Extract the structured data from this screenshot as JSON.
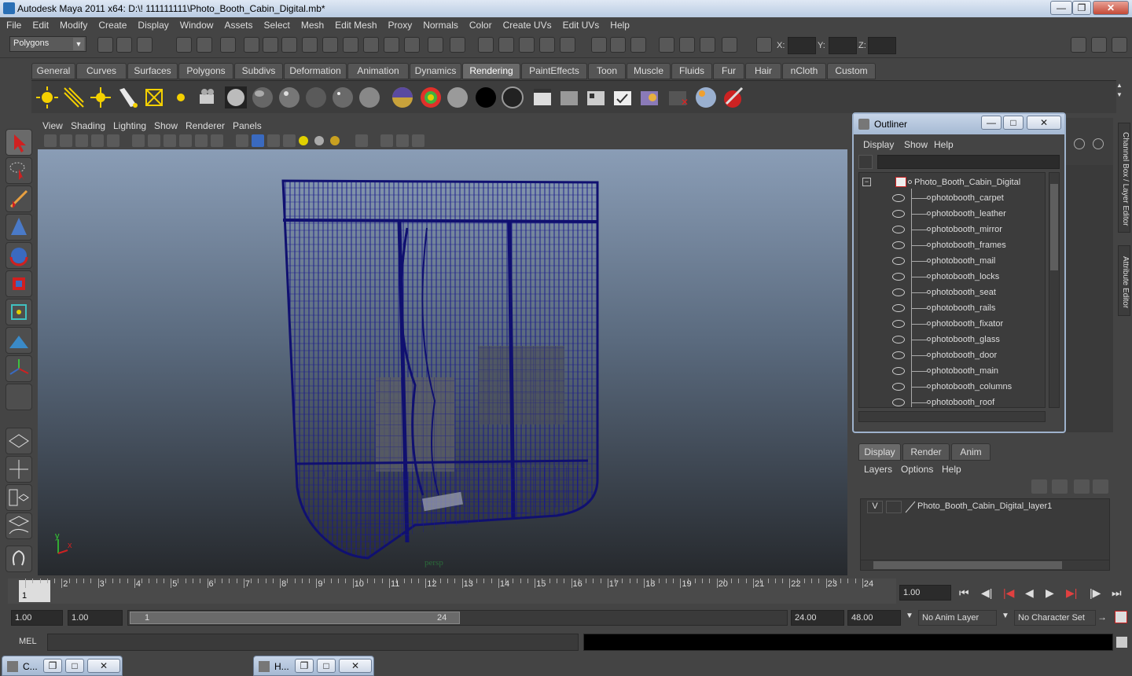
{
  "window": {
    "title": "Autodesk Maya 2011 x64: D:\\! 111111111\\Photo_Booth_Cabin_Digital.mb*"
  },
  "menubar": [
    "File",
    "Edit",
    "Modify",
    "Create",
    "Display",
    "Window",
    "Assets",
    "Select",
    "Mesh",
    "Edit Mesh",
    "Proxy",
    "Normals",
    "Color",
    "Create UVs",
    "Edit UVs",
    "Help"
  ],
  "status_line": {
    "mode": "Polygons",
    "x_label": "X:",
    "y_label": "Y:",
    "z_label": "Z:"
  },
  "shelf": {
    "tabs": [
      "General",
      "Curves",
      "Surfaces",
      "Polygons",
      "Subdivs",
      "Deformation",
      "Animation",
      "Dynamics",
      "Rendering",
      "PaintEffects",
      "Toon",
      "Muscle",
      "Fluids",
      "Fur",
      "Hair",
      "nCloth",
      "Custom"
    ],
    "active_tab": "Rendering"
  },
  "panel": {
    "menu": [
      "View",
      "Shading",
      "Lighting",
      "Show",
      "Renderer",
      "Panels"
    ],
    "camera_label": "persp",
    "axis_x": "x",
    "axis_y": "y"
  },
  "outliner": {
    "title": "Outliner",
    "menu": [
      "Display",
      "Show",
      "Help"
    ],
    "root": "Photo_Booth_Cabin_Digital",
    "items": [
      "photobooth_carpet",
      "photobooth_leather",
      "photobooth_mirror",
      "photobooth_frames",
      "photobooth_mail",
      "photobooth_locks",
      "photobooth_seat",
      "photobooth_rails",
      "photobooth_fixator",
      "photobooth_glass",
      "photobooth_door",
      "photobooth_main",
      "photobooth_columns",
      "photobooth_roof"
    ]
  },
  "side_tabs": {
    "channel_box": "Channel Box / Layer Editor",
    "attribute_editor": "Attribute Editor"
  },
  "layer_editor": {
    "tabs": [
      "Display",
      "Render",
      "Anim"
    ],
    "active_tab": "Display",
    "menu": [
      "Layers",
      "Options",
      "Help"
    ],
    "layer": {
      "visible": "V",
      "name": "Photo_Booth_Cabin_Digital_layer1"
    }
  },
  "time_slider": {
    "ticks": [
      "1",
      "2",
      "3",
      "4",
      "5",
      "6",
      "7",
      "8",
      "9",
      "10",
      "11",
      "12",
      "13",
      "14",
      "15",
      "16",
      "17",
      "18",
      "19",
      "20",
      "21",
      "22",
      "23",
      "24"
    ],
    "current_frame_marker": "1",
    "current_time": "1.00"
  },
  "range_slider": {
    "start_time": "1.00",
    "playback_start": "1.00",
    "range_start_label": "1",
    "range_end_label": "24",
    "playback_end": "24.00",
    "end_time": "48.00",
    "anim_layer": "No Anim Layer",
    "character_set": "No Character Set"
  },
  "command_line": {
    "label": "MEL"
  },
  "minimized_windows": [
    "C...",
    "H..."
  ],
  "colors": {
    "wireframe": "#1a1a8a",
    "viewport_top": "#8a9db6",
    "viewport_bottom": "#26292d",
    "ui_bg": "#444444"
  }
}
